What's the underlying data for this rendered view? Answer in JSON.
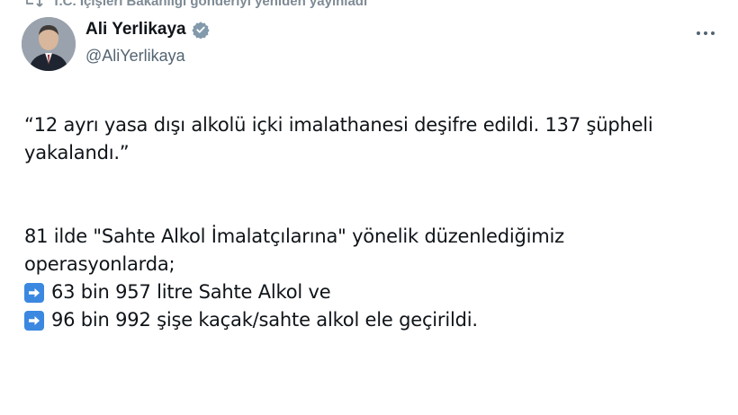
{
  "repost": {
    "text": "T.C. İçişleri Bakanlığı gönderiyi yeniden yayınladı",
    "icon": "repost-icon"
  },
  "author": {
    "display_name": "Ali Yerlikaya",
    "handle": "@AliYerlikaya",
    "verified": true,
    "verified_color": "#829aab"
  },
  "actions": {
    "more_icon": "more-icon"
  },
  "tweet": {
    "quote_line1": "“12 ayrı yasa dışı alkolü içki imalathanesi deşifre edildi. 137 şüpheli",
    "quote_line2": "yakalandı.”",
    "body_line1": "81 ilde \"Sahte Alkol İmalatçılarına\" yönelik düzenlediğimiz",
    "body_line2": "operasyonlarda;",
    "bullets": [
      {
        "icon": "right-arrow-icon",
        "text": "63 bin 957 litre Sahte Alkol ve"
      },
      {
        "icon": "right-arrow-icon",
        "text": "96 bin 992 şişe kaçak/sahte alkol ele geçirildi."
      }
    ]
  },
  "colors": {
    "text": "#0f1419",
    "secondary": "#536471",
    "arrow_emoji_bg": "#3b88e0"
  }
}
